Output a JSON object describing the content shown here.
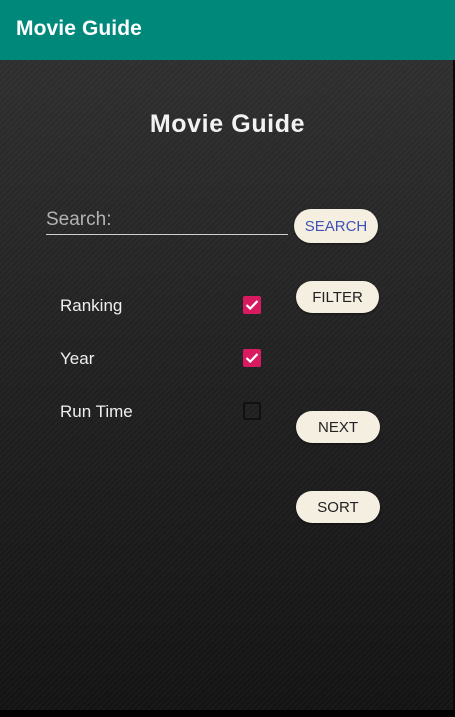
{
  "app_bar": {
    "title": "Movie Guide",
    "color": "#00897b"
  },
  "main": {
    "title": "Movie Guide",
    "search": {
      "placeholder": "Search:",
      "value": ""
    },
    "buttons": {
      "search": "SEARCH",
      "filter": "FILTER",
      "next": "NEXT",
      "sort": "SORT"
    },
    "options": [
      {
        "label": "Ranking",
        "checked": true
      },
      {
        "label": "Year",
        "checked": true
      },
      {
        "label": "Run Time",
        "checked": false
      }
    ],
    "accent_color": "#d81b60",
    "button_color": "#f5efe2"
  }
}
